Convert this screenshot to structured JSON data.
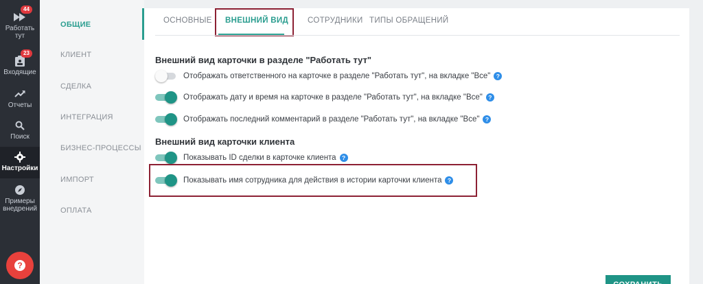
{
  "nav": {
    "items": [
      {
        "label": "Работать тут",
        "badge": "44"
      },
      {
        "label": "Входящие",
        "badge": "23"
      },
      {
        "label": "Отчеты"
      },
      {
        "label": "Поиск"
      },
      {
        "label": "Настройки"
      },
      {
        "label": "Примеры внедрений"
      }
    ],
    "help_label": "?"
  },
  "sections": {
    "items": [
      "ОБЩИЕ",
      "КЛИЕНТ",
      "СДЕЛКА",
      "ИНТЕГРАЦИЯ",
      "БИЗНЕС-ПРОЦЕССЫ",
      "ИМПОРТ",
      "ОПЛАТА"
    ],
    "active": "ОБЩИЕ"
  },
  "tabs": {
    "items": [
      "ОСНОВНЫЕ",
      "ВНЕШНИЙ ВИД",
      "СОТРУДНИКИ",
      "ТИПЫ ОБРАЩЕНИЙ"
    ],
    "active": "ВНЕШНИЙ ВИД"
  },
  "groups": [
    {
      "title": "Внешний вид карточки в разделе \"Работать тут\"",
      "options": [
        {
          "label": "Отображать ответственного на карточке в разделе \"Работать тут\", на вкладке \"Все\"",
          "enabled": false
        },
        {
          "label": "Отображать дату и время на карточке в разделе \"Работать тут\", на вкладке \"Все\"",
          "enabled": true
        },
        {
          "label": "Отображать последний комментарий в разделе \"Работать тут\", на вкладке \"Все\"",
          "enabled": true
        }
      ]
    },
    {
      "title": "Внешний вид карточки клиента",
      "options": [
        {
          "label": "Показывать ID сделки в карточке клиента",
          "enabled": true
        },
        {
          "label": "Показывать имя сотрудника для действия в истории карточки клиента",
          "enabled": true
        }
      ]
    }
  ],
  "help_icon_text": "?",
  "save_label": "СОХРАНИТЬ",
  "colors": {
    "accent": "#1f9486",
    "highlight": "#8c2033",
    "nav_bg": "#2b2f36",
    "help_fab": "#e8413c"
  }
}
